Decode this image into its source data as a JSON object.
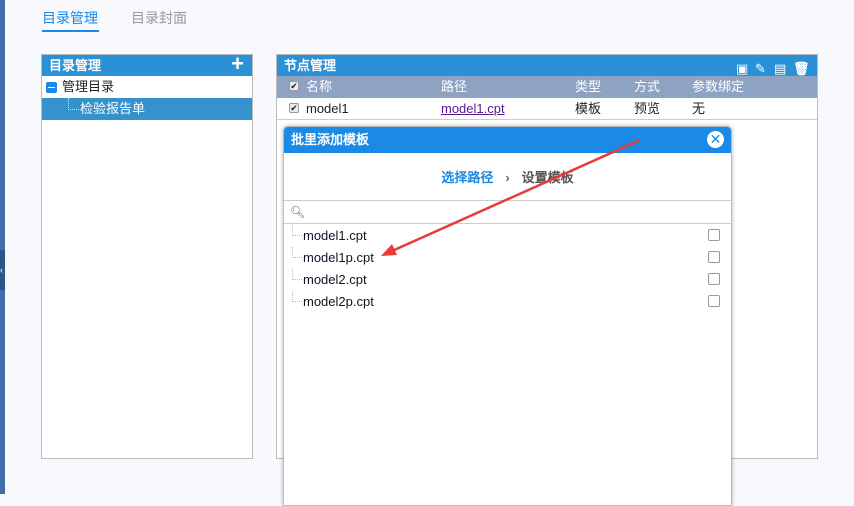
{
  "tabs": [
    {
      "label": "目录管理",
      "active": true
    },
    {
      "label": "目录封面",
      "active": false
    }
  ],
  "left_panel": {
    "title": "目录管理",
    "add_icon": "plus-icon",
    "tree": {
      "root": "管理目录",
      "children": [
        "检验报告单"
      ]
    }
  },
  "right_panel": {
    "title": "节点管理",
    "toolbar_icons": [
      "add-chart-icon",
      "link-icon",
      "edit-icon",
      "trash-icon"
    ],
    "columns": [
      "名称",
      "路径",
      "类型",
      "方式",
      "参数绑定"
    ],
    "rows": [
      {
        "name": "model1",
        "path": "model1.cpt",
        "type": "模板",
        "mode": "预览",
        "params": "无",
        "checked": true
      }
    ]
  },
  "dialog": {
    "title": "批里添加模板",
    "steps": [
      "选择路径",
      "设置模板"
    ],
    "step_separator": "›",
    "search_placeholder": "",
    "items": [
      {
        "name": "model1.cpt",
        "checked": false
      },
      {
        "name": "model1p.cpt",
        "checked": false
      },
      {
        "name": "model2.cpt",
        "checked": false
      },
      {
        "name": "model2p.cpt",
        "checked": false
      }
    ]
  },
  "colors": {
    "accent": "#1a8ae6",
    "panel_header": "#2a91d6",
    "column_header": "#8ea2c1",
    "annotation_arrow": "#e83a3a"
  }
}
